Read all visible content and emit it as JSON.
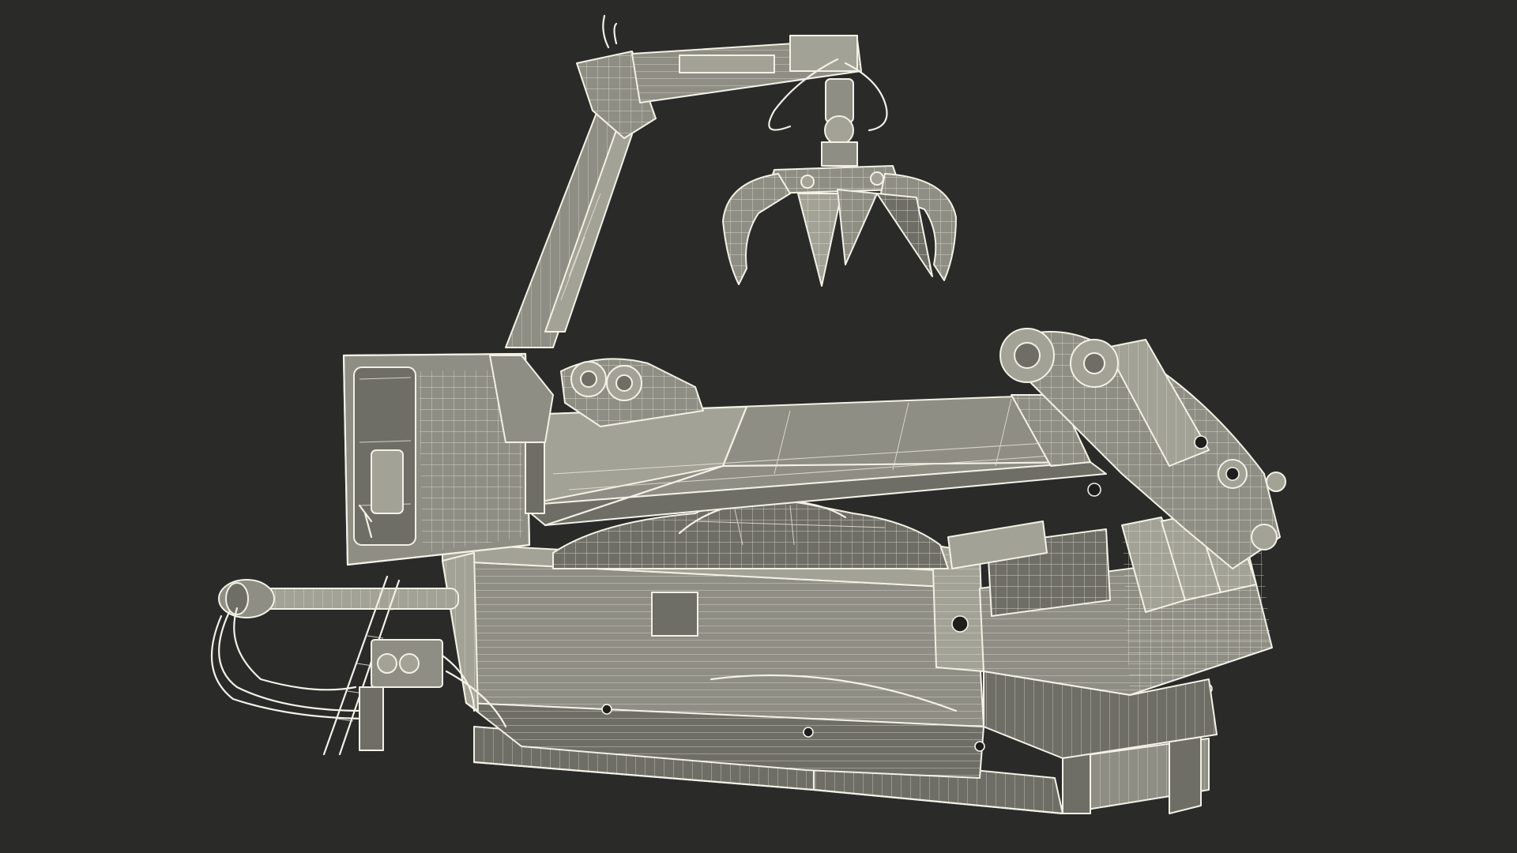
{
  "scene": {
    "subject": "wireframe-car-baler-with-crane",
    "background_color": "#2a2a29",
    "line_color": "#f3f1e6",
    "surface_color": "#8f8e84",
    "shadow_color": "#6f6e66"
  }
}
